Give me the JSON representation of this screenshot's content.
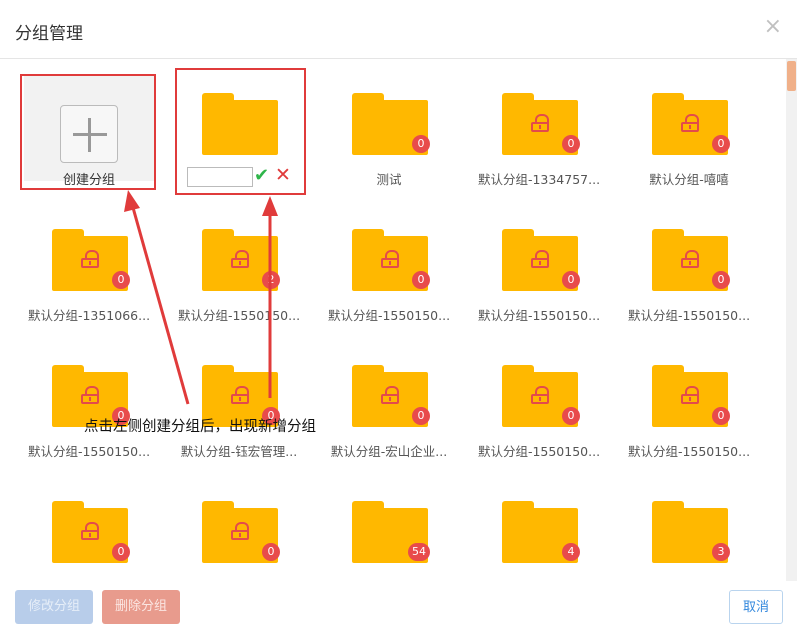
{
  "dialog": {
    "title": "分组管理",
    "close_symbol": "×"
  },
  "create_tile": {
    "label": "创建分组",
    "icon": "plus-icon"
  },
  "new_group": {
    "input_value": "",
    "confirm_icon": "check-icon",
    "cancel_icon": "x-icon",
    "confirm_symbol": "✔",
    "cancel_symbol": "✕"
  },
  "groups": [
    {
      "label": "测试",
      "count": "0",
      "locked": false
    },
    {
      "label": "默认分组-1334757...",
      "count": "0",
      "locked": true
    },
    {
      "label": "默认分组-嘻嘻",
      "count": "0",
      "locked": true
    },
    {
      "label": "默认分组-1351066...",
      "count": "0",
      "locked": true
    },
    {
      "label": "默认分组-1550150...",
      "count": "2",
      "locked": true
    },
    {
      "label": "默认分组-1550150...",
      "count": "0",
      "locked": true
    },
    {
      "label": "默认分组-1550150...",
      "count": "0",
      "locked": true
    },
    {
      "label": "默认分组-1550150...",
      "count": "0",
      "locked": true
    },
    {
      "label": "默认分组-1550150...",
      "count": "0",
      "locked": true
    },
    {
      "label": "默认分组-钰宏管理...",
      "count": "0",
      "locked": true
    },
    {
      "label": "默认分组-宏山企业...",
      "count": "0",
      "locked": true
    },
    {
      "label": "默认分组-1550150...",
      "count": "0",
      "locked": true
    },
    {
      "label": "默认分组-1550150...",
      "count": "0",
      "locked": true
    },
    {
      "label": "",
      "count": "0",
      "locked": true
    },
    {
      "label": "",
      "count": "0",
      "locked": true
    },
    {
      "label": "",
      "count": "54",
      "locked": false
    },
    {
      "label": "",
      "count": "4",
      "locked": false
    },
    {
      "label": "",
      "count": "3",
      "locked": false
    }
  ],
  "annotation": "点击左侧创建分组后，出现新增分组",
  "footer": {
    "edit_label": "修改分组",
    "delete_label": "删除分组",
    "cancel_label": "取消"
  },
  "colors": {
    "folder": "#ffb800",
    "badge": "#e84b4b",
    "highlight": "#e03b3b",
    "confirm": "#2eb54a"
  }
}
